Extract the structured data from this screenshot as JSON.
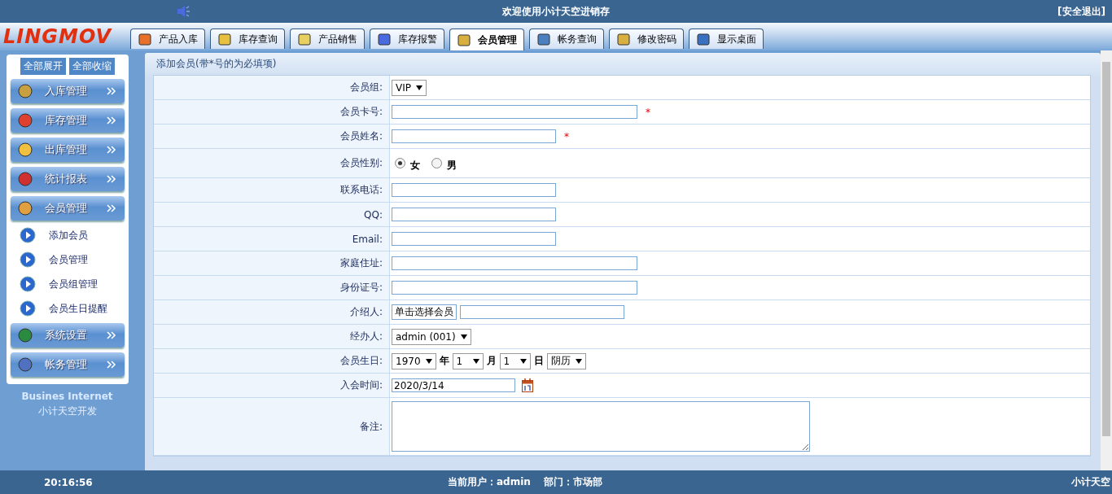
{
  "top_bar": {
    "title": "欢迎使用小计天空进销存",
    "logout": "[安全退出]"
  },
  "logo": "LINGMOV",
  "tabs": [
    {
      "label": "产品入库",
      "selected": false
    },
    {
      "label": "库存查询",
      "selected": false
    },
    {
      "label": "产品销售",
      "selected": false
    },
    {
      "label": "库存报警",
      "selected": false
    },
    {
      "label": "会员管理",
      "selected": true
    },
    {
      "label": "帐务查询",
      "selected": false
    },
    {
      "label": "修改密码",
      "selected": false
    },
    {
      "label": "显示桌面",
      "selected": false
    }
  ],
  "sidebar": {
    "buttons": [
      "全部展开",
      "全部收缩"
    ],
    "items": [
      {
        "label": "入库管理"
      },
      {
        "label": "库存管理"
      },
      {
        "label": "出库管理"
      },
      {
        "label": "统计报表"
      },
      {
        "label": "会员管理",
        "children": [
          {
            "label": "添加会员"
          },
          {
            "label": "会员管理"
          },
          {
            "label": "会员组管理"
          },
          {
            "label": "会员生日提醒"
          }
        ]
      },
      {
        "label": "系统设置"
      },
      {
        "label": "帐务管理"
      }
    ],
    "footer_title": "Busines Internet",
    "footer_subtitle": "小计天空开发"
  },
  "form": {
    "title": "添加会员(带*号的为必填项)",
    "rows": [
      {
        "label": "会员组:",
        "kind": "select",
        "value": "VIP"
      },
      {
        "label": "会员卡号:",
        "kind": "text",
        "wide": true,
        "required_mark": "*"
      },
      {
        "label": "会员姓名:",
        "kind": "text",
        "wide": false,
        "required_mark": "*"
      },
      {
        "label": "会员性别:",
        "kind": "radio",
        "options": [
          {
            "label": "女",
            "selected": true
          },
          {
            "label": "男",
            "selected": false
          }
        ]
      },
      {
        "label": "联系电话:",
        "kind": "text",
        "wide": false
      },
      {
        "label": "QQ:",
        "kind": "text",
        "wide": false
      },
      {
        "label": "Email:",
        "kind": "text",
        "wide": false
      },
      {
        "label": "家庭住址:",
        "kind": "text",
        "wide": true
      },
      {
        "label": "身份证号:",
        "kind": "text",
        "wide": true
      },
      {
        "label": "介绍人:",
        "kind": "picker",
        "button": "单击选择会员"
      },
      {
        "label": "经办人:",
        "kind": "select",
        "value": "admin (001)"
      },
      {
        "label": "会员生日:",
        "kind": "birthday",
        "parts": [
          {
            "value": "1970",
            "unit": "年"
          },
          {
            "value": "1",
            "unit": "月"
          },
          {
            "value": "1",
            "unit": "日"
          }
        ],
        "calendar": "阴历"
      },
      {
        "label": "入会时间:",
        "kind": "date",
        "value": "2020/3/14"
      },
      {
        "label": "备注:",
        "kind": "textarea"
      }
    ]
  },
  "status_bar": {
    "time": "20:16:56",
    "user_label": "当前用户：",
    "user": "admin",
    "dept_label": "部门：",
    "dept": "市场部",
    "credit": "小计天空"
  }
}
